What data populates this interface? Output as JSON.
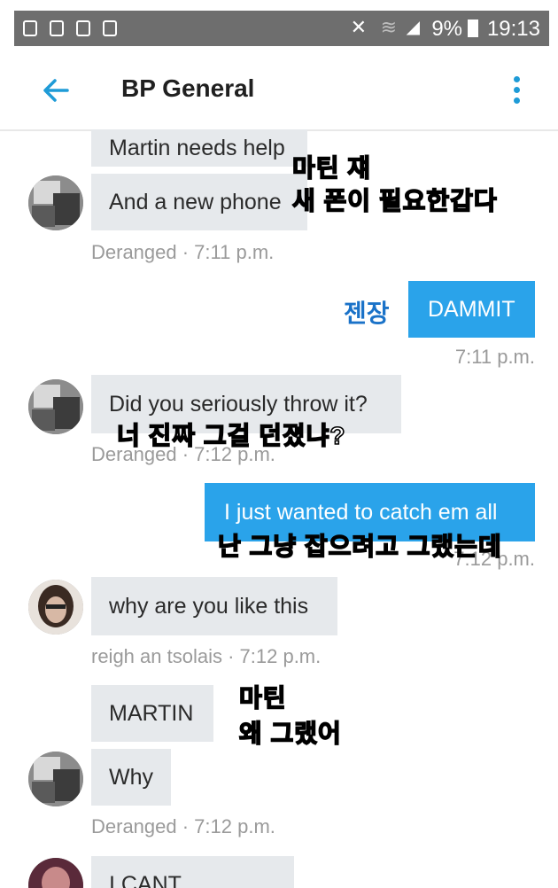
{
  "status_bar": {
    "battery_percent": "9%",
    "time": "19:13",
    "left_icons": [
      "alert-icon",
      "image-icon",
      "clipboard-icon",
      "sd-card-icon"
    ],
    "right_icons": [
      "mute-icon",
      "wifi-icon",
      "signal-icon",
      "battery-icon"
    ]
  },
  "header": {
    "title": "BP General",
    "accent_color": "#1e9bd7"
  },
  "messages": [
    {
      "text": "Martin needs help"
    },
    {
      "text": "And a new phone",
      "meta": "Deranged · 7:11 p.m."
    },
    {
      "text": "DAMMIT",
      "meta": "7:11 p.m."
    },
    {
      "text": "Did you seriously throw it?",
      "meta": "Deranged · 7:12 p.m."
    },
    {
      "text": "I just wanted to catch em all",
      "meta": "7:12 p.m."
    },
    {
      "text": "why are you like this",
      "meta": "reigh an tsolais · 7:12 p.m."
    },
    {
      "text": "MARTIN"
    },
    {
      "text": "Why",
      "meta": "Deranged · 7:12 p.m."
    },
    {
      "text": "I CANT BELIEVE"
    }
  ],
  "overlays": {
    "line1": "마틴 쟤",
    "line2": "새 폰이 필요한갑다",
    "line3": "젠장",
    "line4": "너 진짜 그걸 던졌냐?",
    "line5": "난 그냥 잡으려고 그랬는데",
    "line6": "마틴",
    "line7": "왜 그랬어"
  },
  "colors": {
    "incoming_bubble": "#e6e9ec",
    "outgoing_bubble": "#2aa3ea",
    "meta_text": "#9a9a9a"
  }
}
